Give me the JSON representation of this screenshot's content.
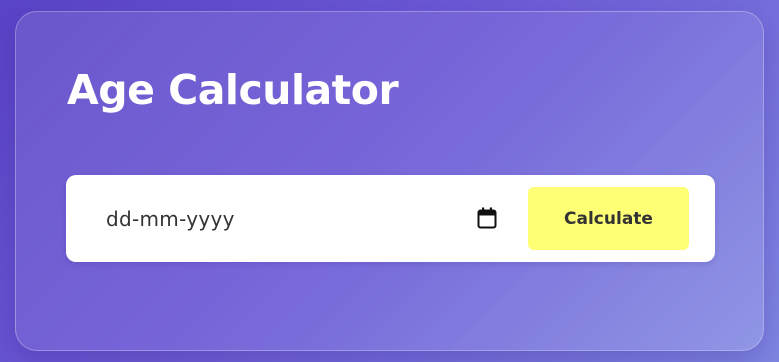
{
  "app": {
    "title": "Age Calculator"
  },
  "date_input": {
    "placeholder": "dd-mm-yyyy",
    "value": "",
    "icon": "calendar-icon"
  },
  "actions": {
    "calculate_label": "Calculate"
  },
  "colors": {
    "background_start": "#5a43c6",
    "background_end": "#7f86e2",
    "button_bg": "#ffff76",
    "button_text": "#333333",
    "title_text": "#ffffff",
    "input_bg": "#ffffff"
  }
}
